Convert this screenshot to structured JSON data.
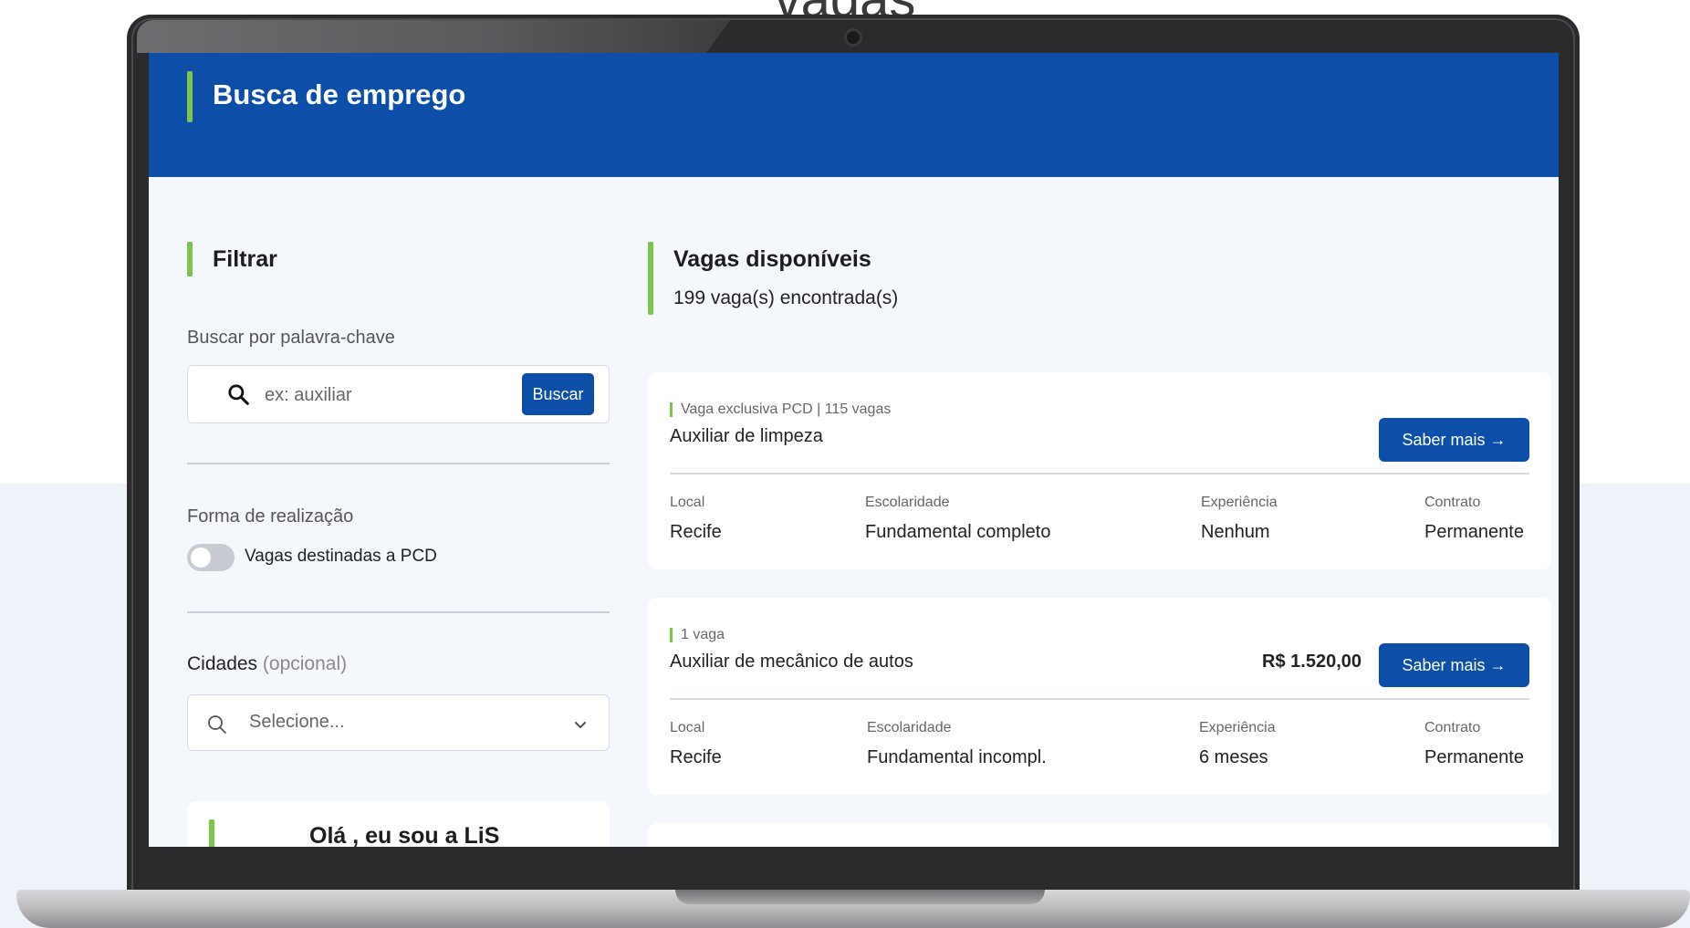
{
  "caption": "vagas",
  "header": {
    "title": "Busca de emprego"
  },
  "filter": {
    "title": "Filtrar",
    "keyword_label": "Buscar por palavra-chave",
    "search_placeholder": "ex: auxiliar",
    "search_button": "Buscar",
    "mode_label": "Forma de realização",
    "pcd_toggle_label": "Vagas destinadas a PCD",
    "pcd_toggle_on": false,
    "cities_label": "Cidades",
    "cities_optional": "(opcional)",
    "cities_placeholder": "Selecione..."
  },
  "assistant": {
    "greeting": "Olá , eu sou a LiS"
  },
  "results": {
    "title": "Vagas disponíveis",
    "count_text": "199 vaga(s) encontrada(s)",
    "jobs": [
      {
        "tag": "Vaga exclusiva PCD | 115 vagas",
        "title": "Auxiliar de limpeza",
        "salary": "",
        "button": "Saber mais →",
        "local_label": "Local",
        "local": "Recife",
        "escolaridade_label": "Escolaridade",
        "escolaridade": "Fundamental completo",
        "experiencia_label": "Experiência",
        "experiencia": "Nenhum",
        "contrato_label": "Contrato",
        "contrato": "Permanente"
      },
      {
        "tag": "1 vaga",
        "title": "Auxiliar de mecânico de autos",
        "salary": "R$ 1.520,00",
        "button": "Saber mais →",
        "local_label": "Local",
        "local": "Recife",
        "escolaridade_label": "Escolaridade",
        "escolaridade": "Fundamental incompl.",
        "experiencia_label": "Experiência",
        "experiencia": "6 meses",
        "contrato_label": "Contrato",
        "contrato": "Permanente"
      }
    ]
  },
  "colors": {
    "primary": "#0c4ea8",
    "accent": "#7ec34b"
  }
}
